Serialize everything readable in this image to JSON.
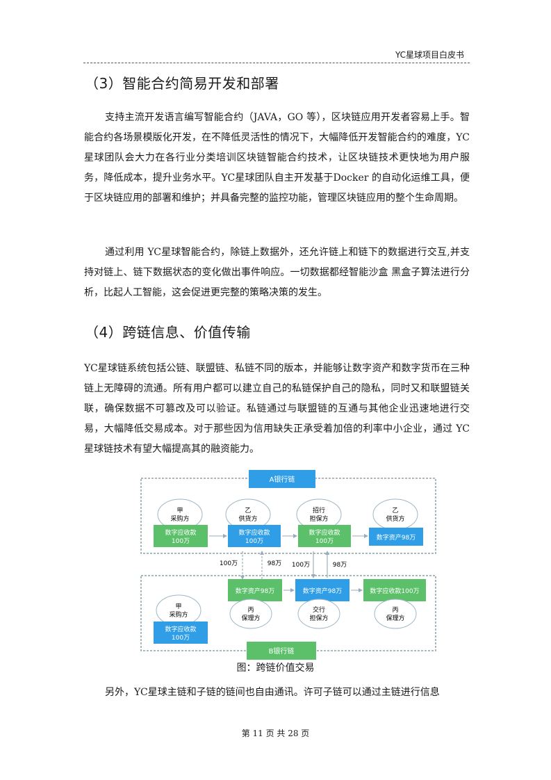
{
  "header": {
    "title": "YC星球项目白皮书"
  },
  "section3": {
    "heading": "（3）智能合约简易开发和部署",
    "para1": "支持主流开发语言编写智能合约（JAVA，GO 等），区块链应用开发者容易上手。智能合约各场景模版化开发，在不降低灵活性的情况下，大幅降低开发智能合约的难度，YC星球团队会大力在各行业分类培训区块链智能合约技术，让区块链技术更快地为用户服务，降低成本，提升业务水平。YC星球团队自主开发基于Docker 的自动化运维工具，便于区块链应用的部署和维护；并具备完整的监控功能，管理区块链应用的整个生命周期。",
    "para2": "通过利用 YC星球智能合约，除链上数据外，还允许链上和链下的数据进行交互,并支持对链上、链下数据状态的变化做出事件响应。一切数据都经智能沙盒 黑盒子算法进行分析，比起人工智能，这会促进更完整的策略决策的发生。"
  },
  "section4": {
    "heading": "（4）跨链信息、价值传输",
    "para1": "YC星球链系统包括公链、联盟链、私链不同的版本，并能够让数字资产和数字货币在三种链上无障碍的流通。所有用户都可以建立自己的私链保护自己的隐私，同时又和联盟链关联，确保数据不可篡改及可以验证。私链通过与联盟链的互通与其他企业迅速地进行交易，大幅降低交易成本。对于那些因为信用缺失正承受着加倍的利率中小企业，通过 YC星球链技术有望大幅提高其的融资能力。"
  },
  "diagram": {
    "top_chain": "A银行链",
    "bottom_chain": "B银行链",
    "top_nodes": [
      {
        "l1": "甲",
        "l2": "采购方",
        "box1": "数字应收款",
        "box2": "100万"
      },
      {
        "l1": "乙",
        "l2": "供货方",
        "box1": "数字应收款",
        "box2": "100万"
      },
      {
        "l1": "招行",
        "l2": "担保方",
        "box1": "数字应收款",
        "box2": "100万"
      },
      {
        "l1": "乙",
        "l2": "供货方",
        "box1": "数字资产98万",
        "box2": ""
      }
    ],
    "bottom_nodes": [
      {
        "l1": "甲",
        "l2": "采购方",
        "box1": "数字应收款",
        "box2": "100万"
      },
      {
        "l1": "丙",
        "l2": "保理方",
        "box1": "数字资产98万",
        "box2": ""
      },
      {
        "l1": "交行",
        "l2": "担保方",
        "box1": "数字资产98万",
        "box2": ""
      },
      {
        "l1": "丙",
        "l2": "保理方",
        "box1": "数字应收款100万",
        "box2": ""
      }
    ],
    "transfers": [
      "100万",
      "98万",
      "100万",
      "98万"
    ],
    "colors": {
      "green": "#5cc06a",
      "blue": "#2f9ee6",
      "dash": "#8aa0a8",
      "circle": "#9fb7c4"
    }
  },
  "caption": "图：跨链价值交易",
  "section5": {
    "para1": "另外，YC星球主链和子链的链间也自由通讯。许可子链可以通过主链进行信息"
  },
  "footer": {
    "page": "第 11 页 共 28 页"
  }
}
